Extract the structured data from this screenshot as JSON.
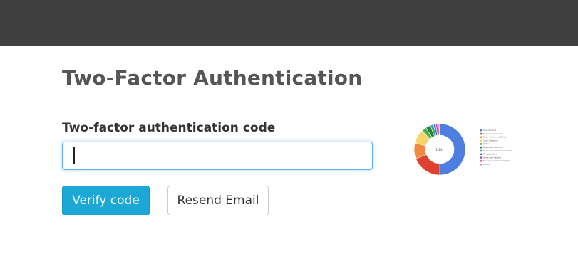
{
  "header": {
    "background": "#404040"
  },
  "page": {
    "title": "Two-Factor Authentication"
  },
  "form": {
    "code_label": "Two-factor authentication code",
    "code_value": "",
    "code_placeholder": "",
    "verify_label": "Verify code",
    "resend_label": "Resend Email"
  },
  "colors": {
    "primary_button": "#1ba8d6",
    "input_focus_border": "#66afe9",
    "title_text": "#555555"
  },
  "chart_data": {
    "type": "pie",
    "center_label": "1,241",
    "series": [
      {
        "name": "Life Insurance",
        "value": 50,
        "color": "#4e7fe0"
      },
      {
        "name": "Intellectual Property",
        "value": 19,
        "color": "#e0412f"
      },
      {
        "name": "Motor Vehicle and Safety",
        "value": 10,
        "color": "#f08a3c"
      },
      {
        "name": "Legal Obligation",
        "value": 9,
        "color": "#f6d56a"
      },
      {
        "name": "ID Docs",
        "value": 3,
        "color": "#4caf50"
      },
      {
        "name": "Restaurant Contracts",
        "value": 3,
        "color": "#2e7d32"
      },
      {
        "name": "Restaurant Contractor Template",
        "value": 2,
        "color": "#26a69a"
      },
      {
        "name": "Mortgage Bind",
        "value": 1.5,
        "color": "#5c6bc0"
      },
      {
        "name": "Restaurant Recipes",
        "value": 1,
        "color": "#ab47bc"
      },
      {
        "name": "Executive Contract Template",
        "value": 1,
        "color": "#ec407a"
      },
      {
        "name": "Others",
        "value": 0.5,
        "color": "#9e9e9e"
      }
    ]
  }
}
